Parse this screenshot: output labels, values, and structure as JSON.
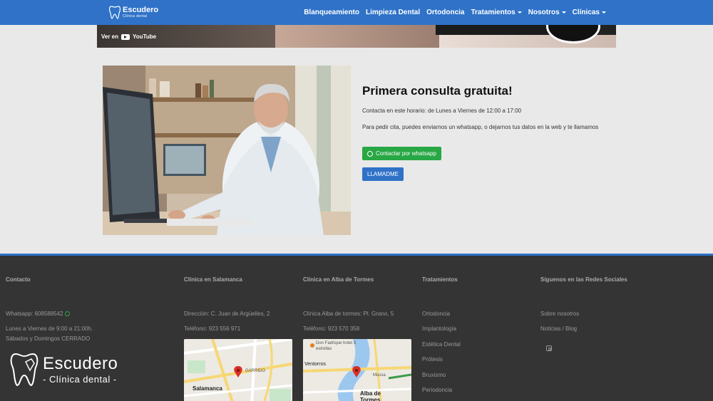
{
  "brand": {
    "name": "Escudero",
    "subtitle": "Clínica dental"
  },
  "nav": {
    "items": [
      {
        "label": "Blanqueamiento",
        "dropdown": false
      },
      {
        "label": "Limpieza Dental",
        "dropdown": false
      },
      {
        "label": "Ortodoncia",
        "dropdown": false
      },
      {
        "label": "Tratamientos",
        "dropdown": true
      },
      {
        "label": "Nosotros",
        "dropdown": true
      },
      {
        "label": "Clínicas",
        "dropdown": true
      }
    ]
  },
  "video": {
    "watch_label": "Ver en",
    "platform": "YouTube"
  },
  "promo": {
    "title": "Primera consulta gratuita!",
    "hours": "Contacta en este horario: de Lunes a Viernes de 12:00 a 17:00",
    "info": "Para pedir cita, puedes enviarnos un whatsapp, o dejarnos tus datos en la web y te llamamos",
    "whatsapp_button": "Contactar por whatsapp",
    "call_button": "LLAMADME"
  },
  "footer": {
    "contact": {
      "heading": "Contacto",
      "whatsapp": "Whatsapp: 608588542",
      "hours_week": "Lunes a Viernes de 9:00 a 21:00h.",
      "hours_weekend": "Sábados y Domingos CERRADO"
    },
    "salamanca": {
      "heading": "Clínica en Salamanca",
      "address": "Dirección: C. Juan de Argüelles, 2",
      "phone": "Teléfono: 923 556 971",
      "map_city": "Salamanca",
      "map_district": "GARRIDO"
    },
    "alba": {
      "heading": "Clínica en Alba de Tormes",
      "address": "Clínica Alba de tormes: Pl. Grano, 5",
      "phone": "Teléfono: 923 570 358",
      "map_city": "Alba de Tormes",
      "map_hotel": "Don Fadrique hotel 3 estrellas",
      "map_place": "Ventorros",
      "map_shop": "Mussa"
    },
    "treatments": {
      "heading": "Tratamientos",
      "items": [
        "Ortodoncia",
        "Implantología",
        "Estética Dental",
        "Prótesis",
        "Bruxismo",
        "Periodoncia"
      ]
    },
    "social": {
      "heading": "Síguenos en las Redes Sociales",
      "links": [
        "Sobre nosotros",
        "Noticias / Blog"
      ],
      "icon": "instagram-icon"
    }
  },
  "colors": {
    "primary": "#2f72c8",
    "whatsapp": "#28a745",
    "footer_bg": "#343434"
  }
}
